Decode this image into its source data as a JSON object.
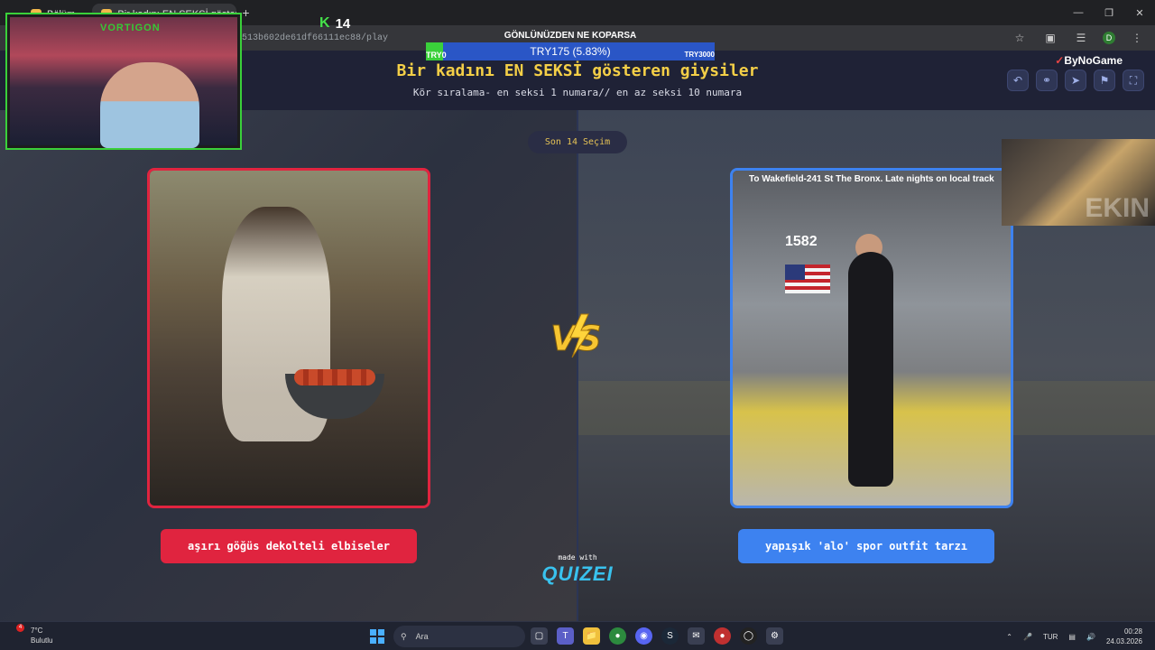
{
  "browser": {
    "tabs": [
      {
        "label": "Bölüm...",
        "active": false
      },
      {
        "label": "Bir kadını EN SEKSİ gösteren gi...",
        "active": true
      }
    ],
    "new_tab_icon": "+",
    "url": "513b602de61df66111ec88/play"
  },
  "quiz": {
    "title": "Bir kadını EN SEKSİ gösteren giysiler",
    "subtitle": "Kör sıralama- en seksi 1 numara// en az seksi 10 numara",
    "brand": "ByNoGame",
    "progress_pill": "Son 14 Seçim",
    "left_option": {
      "label": "aşırı göğüs dekolteli elbiseler"
    },
    "right_option": {
      "label": "yapışık 'alo' spor outfit tarzı",
      "photo_text": "To Wakefield-241 St The Bronx. Late nights on local track",
      "car_number": "1582"
    },
    "vs_text": "VS",
    "made_with": "made with",
    "quizei": "QUIZEI"
  },
  "stream_overlay": {
    "channel": "VORTIGON",
    "kick_count": "14",
    "kick_glyph": "K",
    "donation_title": "GÖNLÜNÜZDEN NE KOPARSA",
    "donation_progress_text": "TRY175 (5.83%)",
    "donation_progress_fraction": 0.0583,
    "donation_min": "TRY0",
    "donation_max": "TRY3000"
  },
  "taskbar": {
    "weather_temp": "7°C",
    "weather_desc": "Bulutlu",
    "weather_badge": "4",
    "search_placeholder": "Ara",
    "language": "TUR",
    "time": "00:28",
    "date": "24.03.2026"
  },
  "colors": {
    "title_yellow": "#f4cf47",
    "left_accent": "#e0243f",
    "right_accent": "#3d82f0",
    "overlay_green": "#3ad03a"
  }
}
